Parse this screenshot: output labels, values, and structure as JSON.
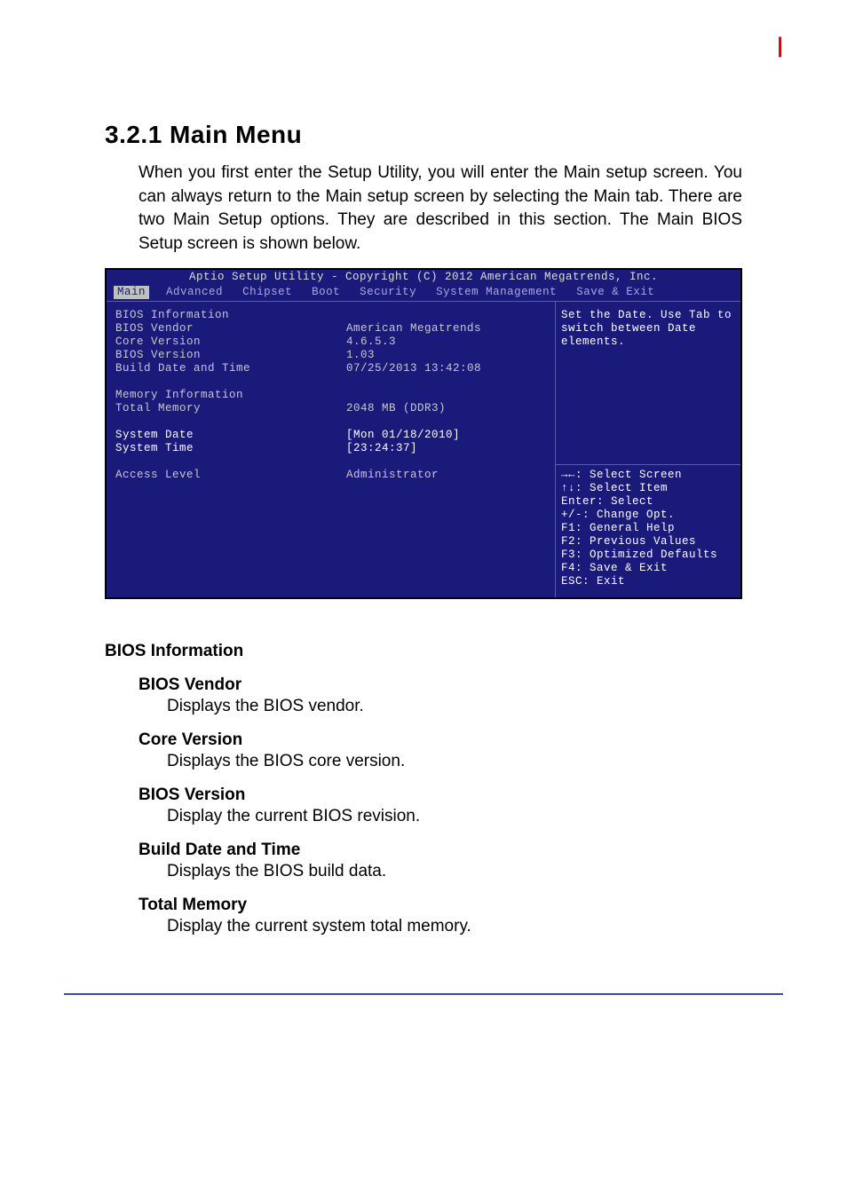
{
  "header_mark": "|",
  "doc": {
    "section_title": "3.2.1 Main Menu",
    "intro": "When you first enter the Setup Utility, you will enter the Main setup screen. You can always return to the Main setup screen by selecting the Main tab. There are two Main Setup options. They are described in this section. The Main BIOS Setup screen is shown below."
  },
  "bios": {
    "title": "Aptio Setup Utility - Copyright (C) 2012 American Megatrends, Inc.",
    "tabs": [
      "Main",
      "Advanced",
      "Chipset",
      "Boot",
      "Security",
      "System Management",
      "Save & Exit"
    ],
    "active_tab": 0,
    "left": {
      "group1_title": "BIOS Information",
      "rows1": [
        {
          "label": "BIOS Vendor",
          "value": "American Megatrends"
        },
        {
          "label": "Core Version",
          "value": "4.6.5.3"
        },
        {
          "label": "BIOS Version",
          "value": "1.03"
        },
        {
          "label": "Build Date and Time",
          "value": "07/25/2013 13:42:08"
        }
      ],
      "group2_title": "Memory Information",
      "rows2": [
        {
          "label": "Total Memory",
          "value": "2048 MB (DDR3)"
        }
      ],
      "editable": [
        {
          "label": "System Date",
          "value": "[Mon 01/18/2010]"
        },
        {
          "label": "System Time",
          "value": "[23:24:37]"
        }
      ],
      "rows3": [
        {
          "label": "Access Level",
          "value": "Administrator"
        }
      ]
    },
    "right": {
      "help": "Set the Date. Use Tab to switch between Date elements.",
      "keys": [
        "→←: Select Screen",
        "↑↓: Select Item",
        "Enter: Select",
        "+/-: Change Opt.",
        "F1: General Help",
        "F2: Previous Values",
        "F3: Optimized Defaults",
        "F4: Save & Exit",
        "ESC: Exit"
      ]
    }
  },
  "descriptions": {
    "heading": "BIOS Information",
    "items": [
      {
        "sub": "BIOS Vendor",
        "text": "Displays the BIOS vendor."
      },
      {
        "sub": "Core Version",
        "text": "Displays the BIOS core version."
      },
      {
        "sub": "BIOS Version",
        "text": "Display the current BIOS revision."
      },
      {
        "sub": "Build Date and Time",
        "text": "Displays the BIOS build data."
      },
      {
        "sub": "Total Memory",
        "text": "Display the current system total memory."
      }
    ]
  }
}
